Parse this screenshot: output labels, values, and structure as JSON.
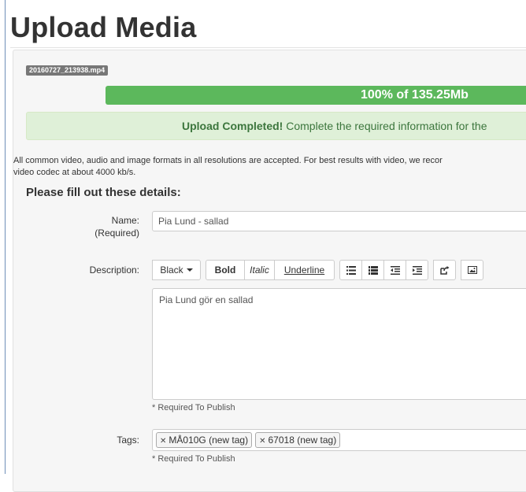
{
  "page": {
    "title": "Upload Media"
  },
  "upload": {
    "filename": "20160727_213938.mp4",
    "progress_text": "100% of 135.25Mb",
    "progress": 1.0
  },
  "alert": {
    "strong": "Upload Completed!",
    "text": " Complete the required information for the"
  },
  "info": {
    "line1": "All common video, audio and image formats in all resolutions are accepted.  For best results with video, we recor",
    "line2": "video codec at about 4000 kb/s."
  },
  "form": {
    "section_title": "Please fill out these details:",
    "name": {
      "label": "Name:",
      "sublabel": "(Required)",
      "value": "Pia Lund - sallad"
    },
    "description": {
      "label": "Description:",
      "toolbar": {
        "color": "Black",
        "bold": "Bold",
        "italic": "Italic",
        "underline": "Underline"
      },
      "value": "Pia Lund gör en sallad",
      "hint": "* Required To Publish"
    },
    "tags": {
      "label": "Tags:",
      "items": [
        "MÅ010G (new tag)",
        "67018 (new tag)"
      ],
      "hint": "* Required To Publish"
    }
  },
  "colors": {
    "accent": "#5cb85c",
    "alert_bg": "#dff0d8",
    "alert_text": "#3c763d",
    "badge": "#777777"
  }
}
